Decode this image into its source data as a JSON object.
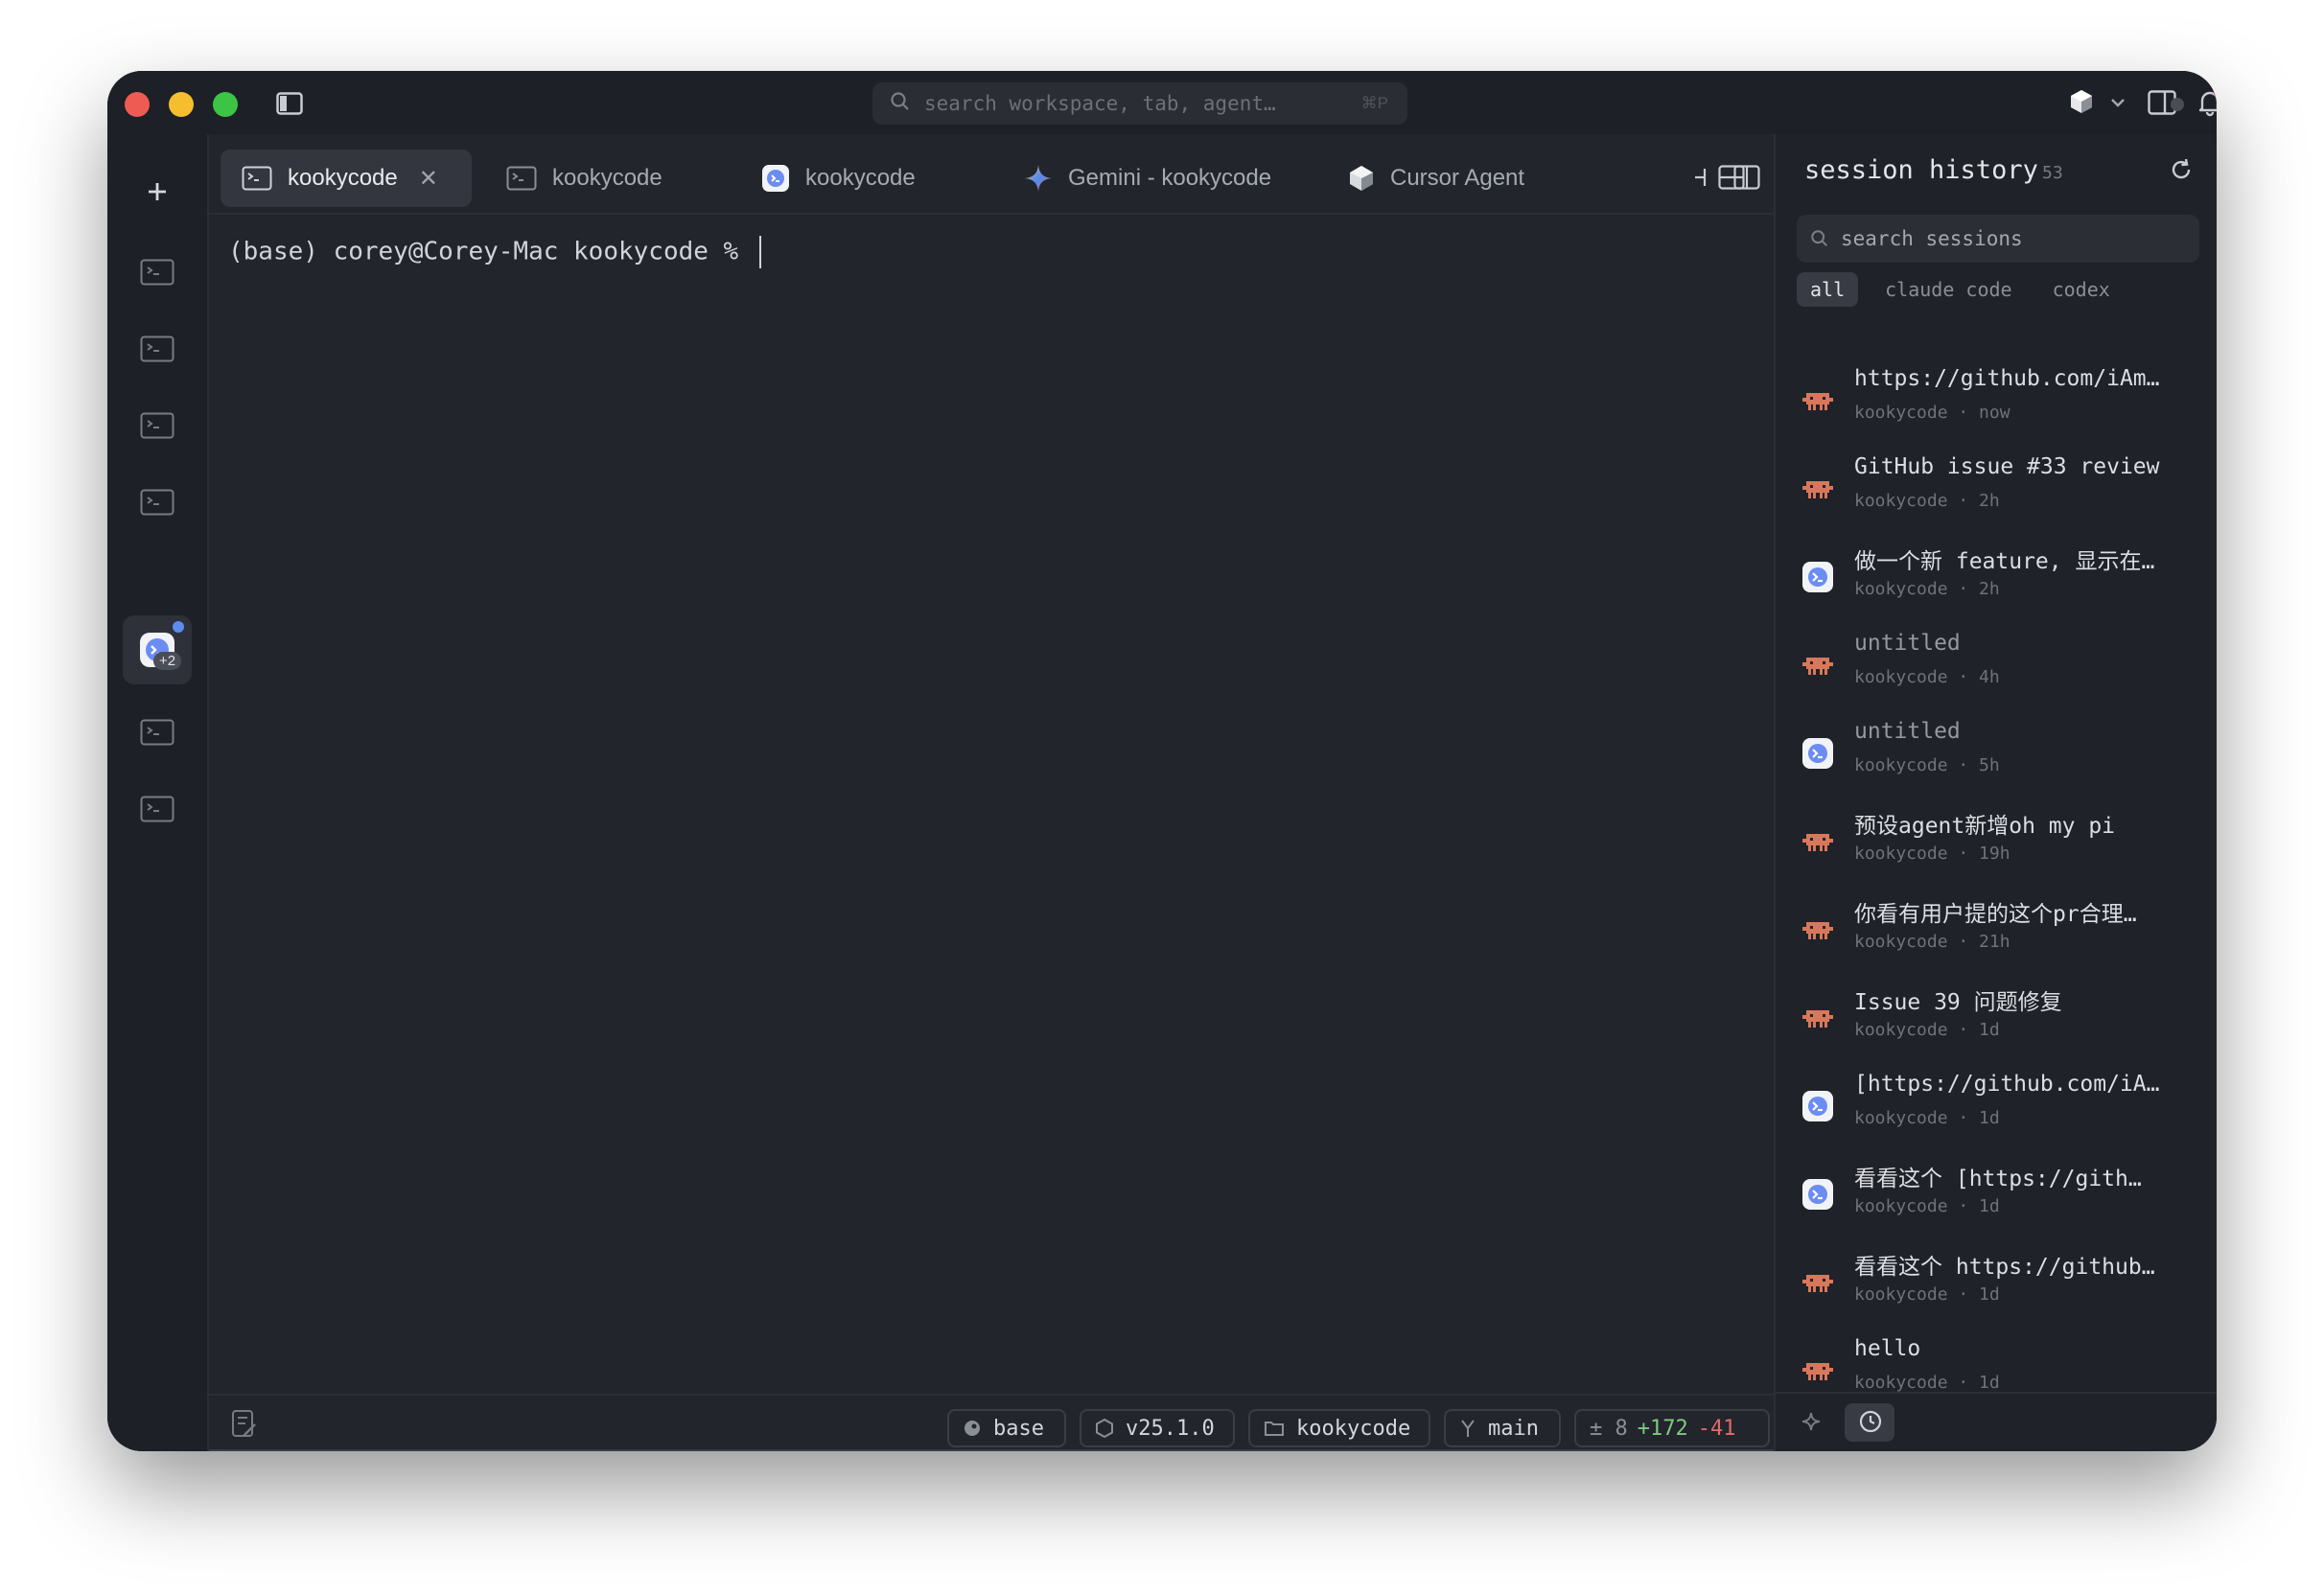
{
  "titlebar": {
    "search_placeholder": "search workspace, tab, agent…",
    "search_shortcut": "⌘P"
  },
  "tabs": [
    {
      "label": "kookycode",
      "icon": "terminal-icon",
      "active": true
    },
    {
      "label": "kookycode",
      "icon": "terminal-icon",
      "active": false
    },
    {
      "label": "kookycode",
      "icon": "agent-face-icon",
      "active": false
    },
    {
      "label": "Gemini - kookycode",
      "icon": "gemini-sparkle-icon",
      "active": false
    },
    {
      "label": "Cursor Agent",
      "icon": "cursor-cube-icon",
      "active": false
    }
  ],
  "rail": {
    "badge": "+2"
  },
  "terminal": {
    "prompt": "(base) corey@Corey-Mac kookycode % "
  },
  "statusbar": {
    "env": "base",
    "version": "v25.1.0",
    "folder": "kookycode",
    "branch": "main",
    "diff_files": "± 8",
    "additions": "+172",
    "deletions": "-41"
  },
  "panel": {
    "title": "session history",
    "count": "53",
    "search_placeholder": "search sessions",
    "filters": [
      "all",
      "claude code",
      "codex"
    ]
  },
  "sessions": [
    {
      "title": "https://github.com/iAm…",
      "meta": "kookycode · now",
      "agent": "claude"
    },
    {
      "title": "GitHub issue #33 review",
      "meta": "kookycode · 2h",
      "agent": "claude"
    },
    {
      "title": "做一个新 feature, 显示在…",
      "meta": "kookycode · 2h",
      "agent": "codex"
    },
    {
      "title": "untitled",
      "meta": "kookycode · 4h",
      "agent": "claude"
    },
    {
      "title": "untitled",
      "meta": "kookycode · 5h",
      "agent": "codex"
    },
    {
      "title": "预设agent新增oh my pi",
      "meta": "kookycode · 19h",
      "agent": "claude"
    },
    {
      "title": "你看有用户提的这个pr合理…",
      "meta": "kookycode · 21h",
      "agent": "claude"
    },
    {
      "title": "Issue 39 问题修复",
      "meta": "kookycode · 1d",
      "agent": "claude"
    },
    {
      "title": "[https://github.com/iA…",
      "meta": "kookycode · 1d",
      "agent": "codex"
    },
    {
      "title": "看看这个 [https://gith…",
      "meta": "kookycode · 1d",
      "agent": "codex"
    },
    {
      "title": "看看这个 https://github…",
      "meta": "kookycode · 1d",
      "agent": "claude"
    },
    {
      "title": "hello",
      "meta": "kookycode · 1d",
      "agent": "claude"
    }
  ],
  "colors": {
    "background": "#22252c",
    "claude_accent": "#d9775b",
    "codex_accent": "#6b8cf2",
    "additions": "#7fc97f",
    "deletions": "#e06c6c"
  }
}
